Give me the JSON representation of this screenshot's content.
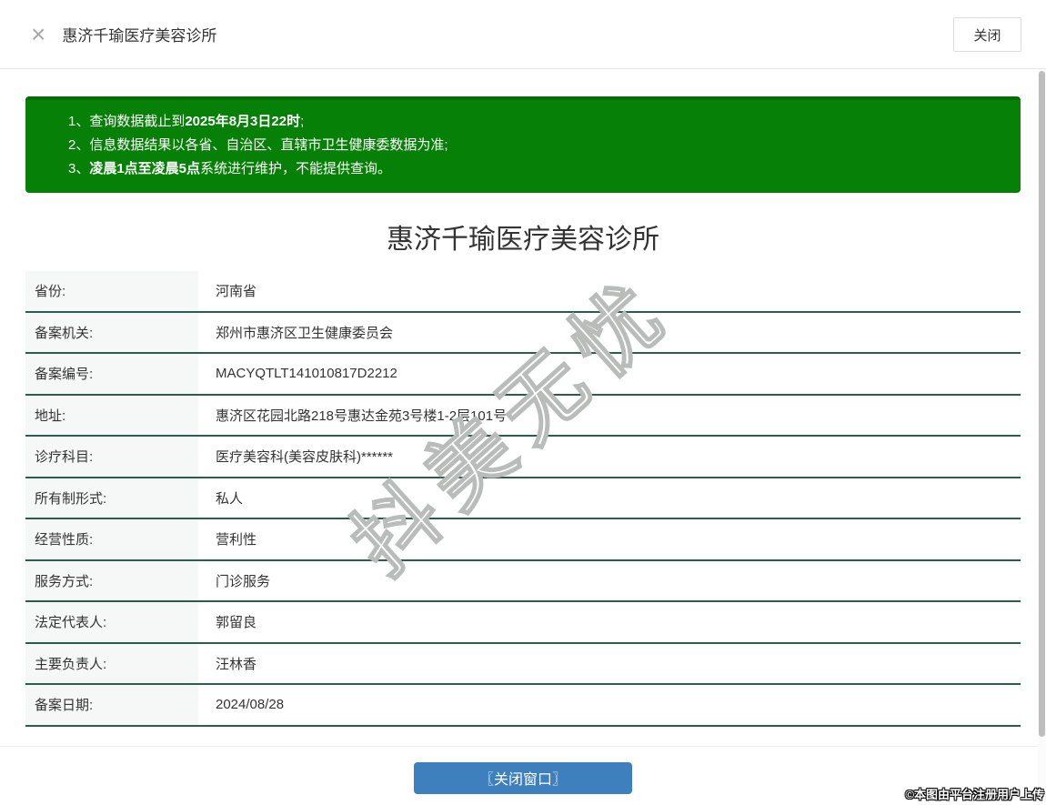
{
  "header": {
    "close_icon": "×",
    "title": "惠济千瑜医疗美容诊所",
    "close_button": "关闭"
  },
  "notice": {
    "lines": [
      {
        "pre": "1、查询数据截止到",
        "bold": "2025年8月3日22时",
        "post": ";"
      },
      {
        "pre": "2、信息数据结果以各省、自治区、直辖市卫生健康委数据为准;",
        "bold": "",
        "post": ""
      },
      {
        "pre": "3、",
        "bold": "凌晨1点至凌晨5点",
        "post": "系统进行维护，不能提供查询。"
      }
    ]
  },
  "main": {
    "title": "惠济千瑜医疗美容诊所",
    "rows": [
      {
        "label": "省份:",
        "value": "河南省"
      },
      {
        "label": "备案机关:",
        "value": "郑州市惠济区卫生健康委员会"
      },
      {
        "label": "备案编号:",
        "value": "MACYQTLT141010817D2212"
      },
      {
        "label": "地址:",
        "value": "惠济区花园北路218号惠达金苑3号楼1-2层101号"
      },
      {
        "label": "诊疗科目:",
        "value": "医疗美容科(美容皮肤科)******"
      },
      {
        "label": "所有制形式:",
        "value": "私人"
      },
      {
        "label": "经营性质:",
        "value": "营利性"
      },
      {
        "label": "服务方式:",
        "value": "门诊服务"
      },
      {
        "label": "法定代表人:",
        "value": "郭留良"
      },
      {
        "label": "主要负责人:",
        "value": "汪林香"
      },
      {
        "label": "备案日期:",
        "value": "2024/08/28"
      }
    ]
  },
  "footer": {
    "close_window_button": "〖关闭窗口〗"
  },
  "watermark": {
    "diagonal_text": "抖美无忧",
    "copyright": "©本图由平台注册用户上传"
  },
  "colors": {
    "notice_green": "#078007",
    "divider_teal": "#2a5c50",
    "button_blue": "#3d80bd",
    "label_bg": "#f6f7f7"
  }
}
